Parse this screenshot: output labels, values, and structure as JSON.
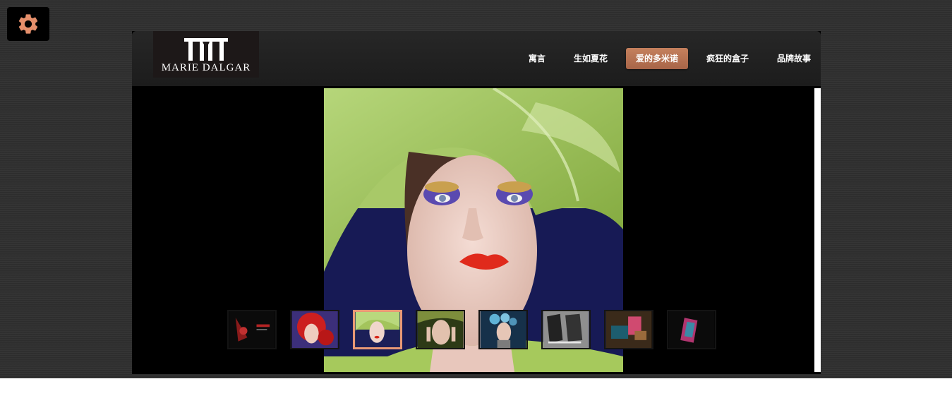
{
  "brand": {
    "logo_text": "MARIE DALGAR",
    "accent_color": "#b8714f"
  },
  "settings": {
    "icon": "gear-icon",
    "color": "#e58f6b"
  },
  "nav": {
    "items": [
      {
        "label": "寓言",
        "active": false
      },
      {
        "label": "生如夏花",
        "active": false
      },
      {
        "label": "爱的多米诺",
        "active": true
      },
      {
        "label": "疯狂的盒子",
        "active": false
      },
      {
        "label": "品牌故事",
        "active": false
      }
    ]
  },
  "gallery": {
    "selected_index": 2,
    "thumbnail_count": 8
  }
}
